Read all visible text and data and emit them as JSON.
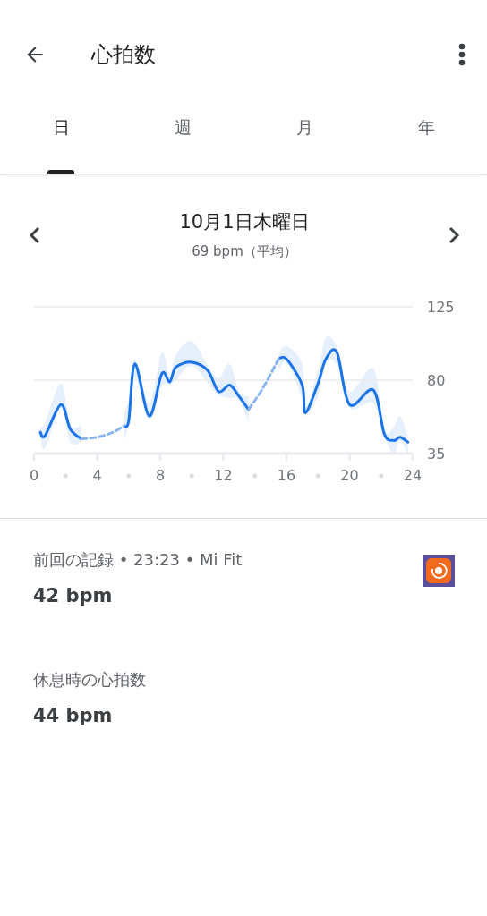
{
  "app_bar": {
    "title": "心拍数"
  },
  "tabs": [
    {
      "label": "日",
      "selected": true
    },
    {
      "label": "週",
      "selected": false
    },
    {
      "label": "月",
      "selected": false
    },
    {
      "label": "年",
      "selected": false
    }
  ],
  "day": {
    "date": "10月1日木曜日",
    "average": "69 bpm（平均）"
  },
  "chart_data": {
    "type": "line",
    "xlim": [
      0,
      24
    ],
    "ylim": [
      35,
      125
    ],
    "xticks": [
      0,
      4,
      8,
      12,
      16,
      20,
      24
    ],
    "yticks": [
      35,
      80,
      125
    ],
    "x": [
      0.4,
      0.7,
      1.7,
      2.3,
      3.0,
      4.0,
      5.0,
      5.7,
      6.0,
      6.4,
      7.3,
      8.1,
      8.6,
      9.0,
      10.0,
      11.0,
      11.7,
      12.4,
      13.0,
      13.6,
      14.5,
      15.5,
      16.0,
      17.0,
      17.2,
      18.0,
      18.5,
      19.2,
      20.0,
      21.5,
      22.2,
      22.8,
      23.2,
      23.7
    ],
    "series": [
      {
        "color": "#1a73e8",
        "line_style": "solid",
        "values": [
          48,
          46,
          65,
          50,
          44,
          null,
          null,
          52,
          55,
          90,
          58,
          84,
          79,
          88,
          91,
          86,
          73,
          77,
          70,
          62,
          null,
          93,
          93,
          77,
          60,
          78,
          93,
          97,
          65,
          74,
          47,
          43,
          45,
          42
        ]
      },
      {
        "color": "#8ab4f0",
        "line_style": "dashed",
        "values": [
          null,
          null,
          null,
          null,
          44,
          45,
          48,
          52,
          null,
          null,
          null,
          null,
          null,
          null,
          null,
          null,
          null,
          null,
          null,
          62,
          75,
          93,
          null,
          null,
          null,
          null,
          null,
          null,
          null,
          null,
          null,
          null,
          null,
          null
        ]
      }
    ]
  },
  "latest": {
    "label": "前回の記録 • 23:23 • Mi Fit",
    "value": "42 bpm"
  },
  "resting": {
    "label": "休息時の心拍数",
    "value": "44 bpm"
  }
}
